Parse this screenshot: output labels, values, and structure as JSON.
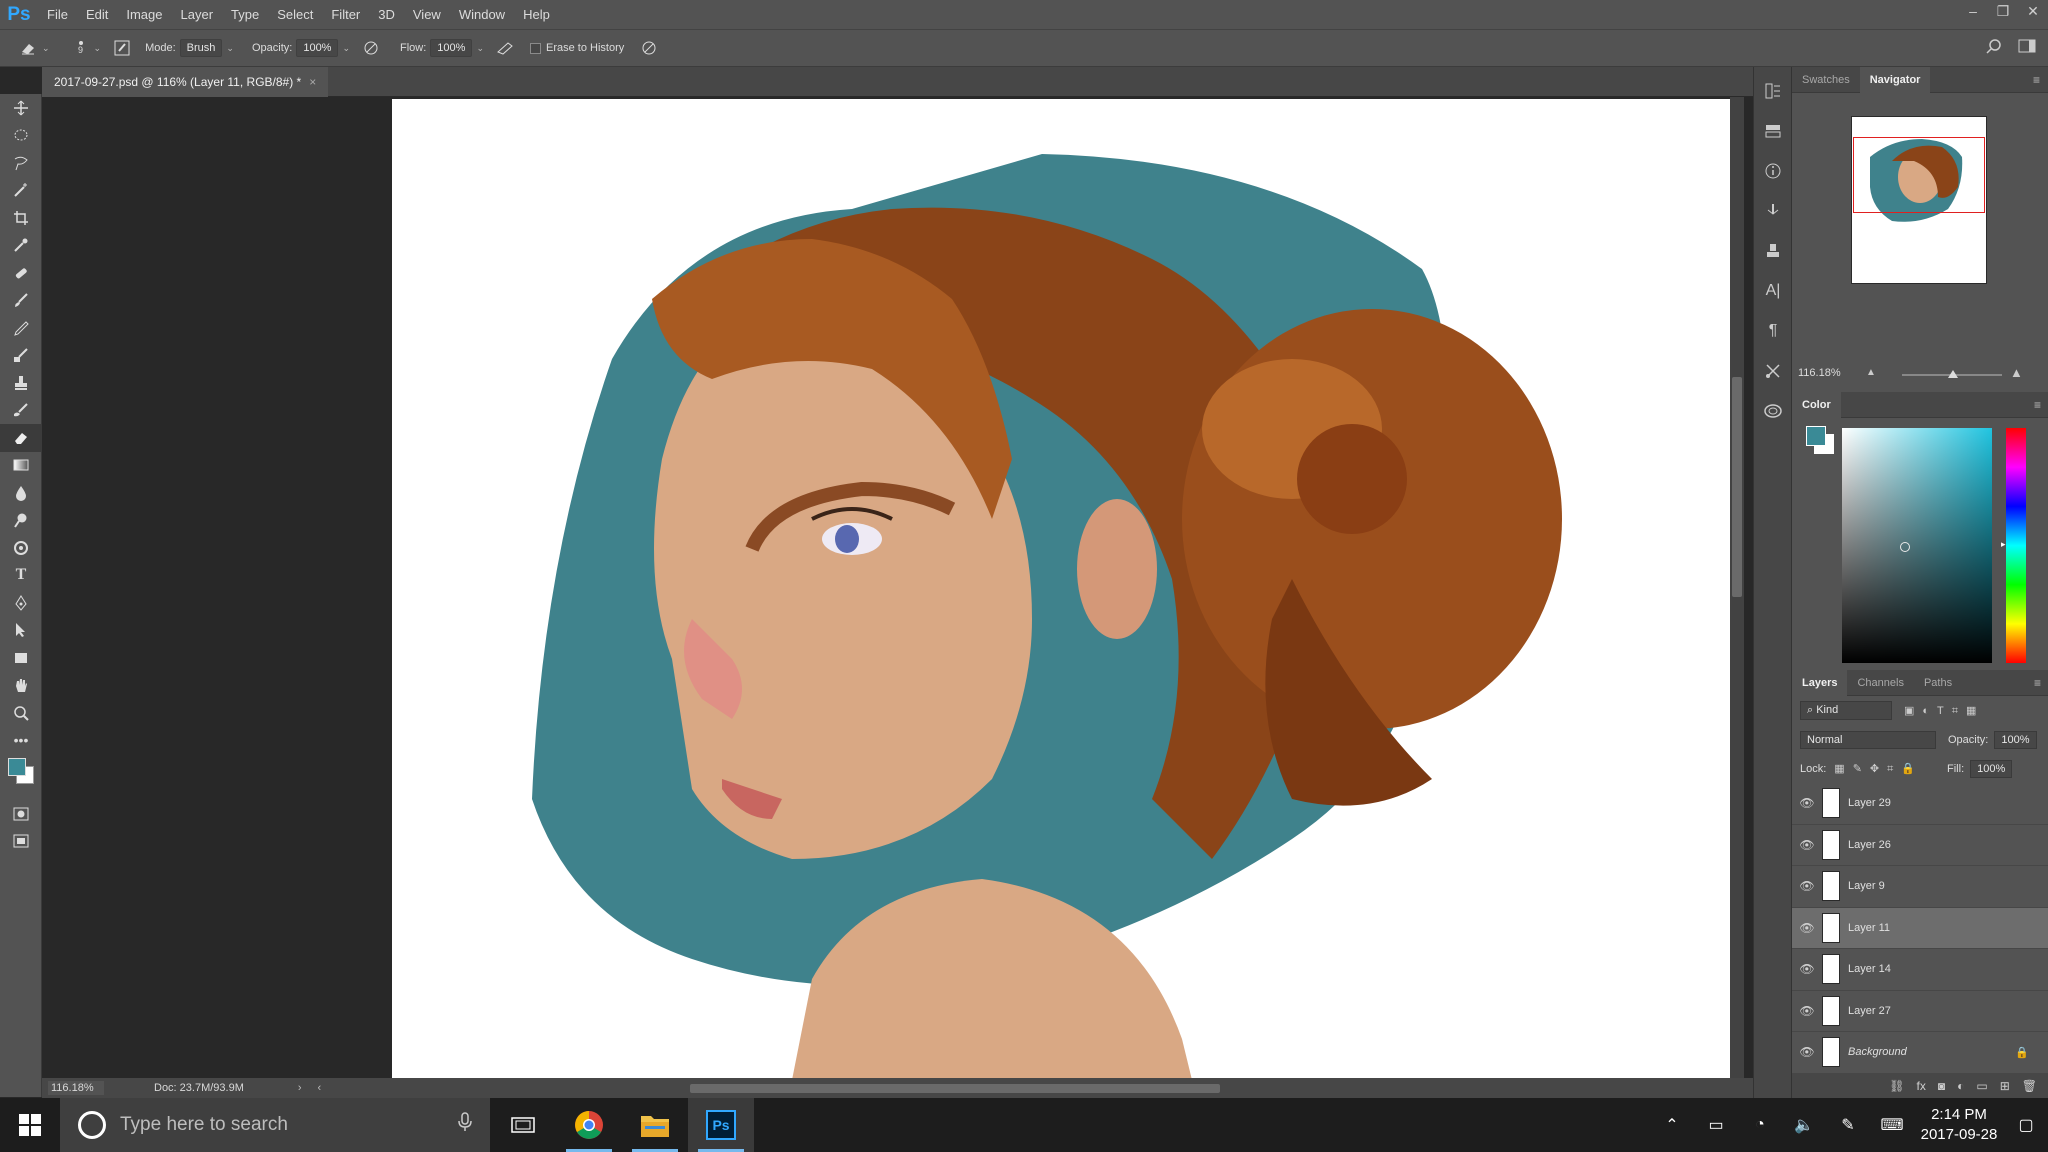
{
  "app": {
    "logo": "Ps"
  },
  "menu": [
    "File",
    "Edit",
    "Image",
    "Layer",
    "Type",
    "Select",
    "Filter",
    "3D",
    "View",
    "Window",
    "Help"
  ],
  "window_controls": [
    "–",
    "❐",
    "✕"
  ],
  "options": {
    "brush_size": "9",
    "mode_label": "Mode:",
    "mode_value": "Brush",
    "opacity_label": "Opacity:",
    "opacity_value": "100%",
    "flow_label": "Flow:",
    "flow_value": "100%",
    "erase_to_history": "Erase to History"
  },
  "tools": [
    "move-tool",
    "marquee-tool",
    "lasso-tool",
    "magic-wand-tool",
    "crop-tool",
    "eyedropper-tool",
    "healing-brush-tool",
    "brush-tool",
    "clone-stamp-tool",
    "history-brush-tool",
    "eraser-tool",
    "gradient-tool",
    "blur-tool",
    "dodge-tool",
    "pen-tool",
    "type-tool",
    "path-selection-tool",
    "rectangle-tool",
    "hand-tool",
    "zoom-tool",
    "more-tools"
  ],
  "document": {
    "tab_title": "2017-09-27.psd @ 116% (Layer 11, RGB/8#) *",
    "close": "×"
  },
  "status": {
    "zoom": "116.18%",
    "doc_info": "Doc: 23.7M/93.9M"
  },
  "navigator": {
    "tabs": [
      "Swatches",
      "Navigator"
    ],
    "active": "Navigator",
    "zoom": "116.18%"
  },
  "color": {
    "title": "Color",
    "foreground": "#3a8a96",
    "background": "#ffffff"
  },
  "layers": {
    "tabs": [
      "Layers",
      "Channels",
      "Paths"
    ],
    "kind_label": "Kind",
    "blend_mode": "Normal",
    "opacity_label": "Opacity:",
    "opacity_value": "100%",
    "lock_label": "Lock:",
    "fill_label": "Fill:",
    "fill_value": "100%",
    "items": [
      {
        "name": "Layer 29",
        "selected": false
      },
      {
        "name": "Layer 26",
        "selected": false
      },
      {
        "name": "Layer 9",
        "selected": false
      },
      {
        "name": "Layer 11",
        "selected": true
      },
      {
        "name": "Layer 14",
        "selected": false
      },
      {
        "name": "Layer 27",
        "selected": false
      },
      {
        "name": "Background",
        "selected": false,
        "locked": true
      }
    ]
  },
  "taskbar": {
    "search_placeholder": "Type here to search",
    "time": "2:14 PM",
    "date": "2017-09-28",
    "apps": [
      "chrome",
      "file-explorer",
      "photoshop"
    ]
  }
}
